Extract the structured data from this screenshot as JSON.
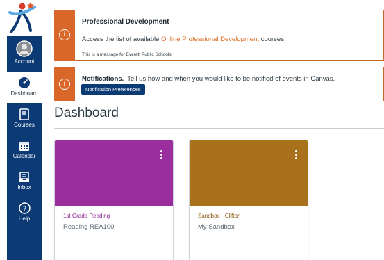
{
  "sidebar": {
    "items": [
      {
        "label": "Account",
        "icon": "account-avatar-icon"
      },
      {
        "label": "Dashboard",
        "icon": "dashboard-gauge-icon"
      },
      {
        "label": "Courses",
        "icon": "courses-book-icon"
      },
      {
        "label": "Calendar",
        "icon": "calendar-icon"
      },
      {
        "label": "Inbox",
        "icon": "inbox-icon"
      },
      {
        "label": "Help",
        "icon": "help-icon"
      }
    ]
  },
  "banners": {
    "pd": {
      "title": "Professional Development",
      "text_before": "Access the list of available ",
      "link": "Online Professional Development",
      "text_after": " courses.",
      "small": "This is a message for Everett Public Schools"
    },
    "notif": {
      "title": "Notifications.",
      "text": "Tell us how and when you would like to be notified of events in Canvas.",
      "button": "Notification Preferences"
    }
  },
  "dashboard": {
    "title": "Dashboard",
    "cards": [
      {
        "title": "1st Grade Reading",
        "subtitle": "Reading REA100",
        "color": "#9a2e9e",
        "title_color": "#8a1d8f"
      },
      {
        "title": "Sandbox - Clifton",
        "subtitle": "My Sandbox",
        "color": "#a9711b",
        "title_color": "#8b5a12"
      }
    ]
  },
  "colors": {
    "nav_bg": "#0b3a75",
    "banner_accent": "#d9672a"
  }
}
